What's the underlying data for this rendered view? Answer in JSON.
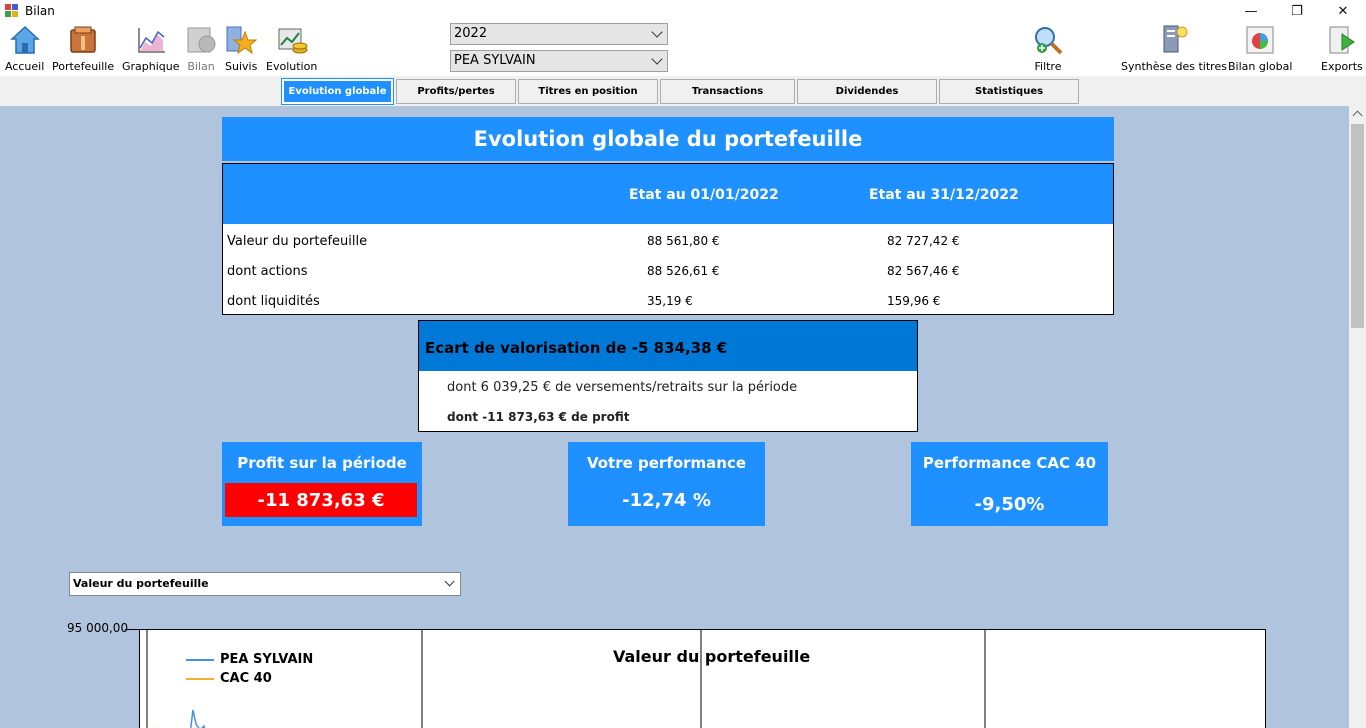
{
  "window": {
    "title": "Bilan",
    "minimize": "—",
    "restore": "❐",
    "close": "✕"
  },
  "toolbar": {
    "items": [
      {
        "label": "Accueil",
        "icon": "home-icon"
      },
      {
        "label": "Portefeuille",
        "icon": "portfolio-icon"
      },
      {
        "label": "Graphique",
        "icon": "chart-icon"
      },
      {
        "label": "Bilan",
        "icon": "balance-icon"
      },
      {
        "label": "Suivis",
        "icon": "star-icon"
      },
      {
        "label": "Evolution",
        "icon": "evolution-icon"
      },
      {
        "label": "Filtre",
        "icon": "filter-icon"
      },
      {
        "label": "Synthèse des titres",
        "icon": "summary-icon"
      },
      {
        "label": "Bilan global",
        "icon": "global-report-icon"
      },
      {
        "label": "Exports",
        "icon": "export-icon"
      }
    ],
    "year_select": "2022",
    "portfolio_select": "PEA SYLVAIN"
  },
  "tabs": [
    {
      "label": "Evolution globale",
      "active": true
    },
    {
      "label": "Profits/pertes",
      "active": false
    },
    {
      "label": "Titres en position",
      "active": false
    },
    {
      "label": "Transactions",
      "active": false
    },
    {
      "label": "Dividendes",
      "active": false
    },
    {
      "label": "Statistiques",
      "active": false
    }
  ],
  "main": {
    "banner": "Evolution globale du portefeuille",
    "etat": {
      "col1": "Etat au 01/01/2022",
      "col2": "Etat au 31/12/2022",
      "rows": [
        {
          "label": "Valeur du portefeuille",
          "v1": "88 561,80 €",
          "v2": "82 727,42 €"
        },
        {
          "label": "dont actions",
          "v1": "88 526,61 €",
          "v2": "82 567,46 €"
        },
        {
          "label": "dont liquidités",
          "v1": "35,19 €",
          "v2": "159,96 €"
        }
      ]
    },
    "ecart": {
      "title": "Ecart de valorisation de -5 834,38 €",
      "line1": "dont 6 039,25 € de versements/retraits sur la période",
      "line2": "dont -11 873,63 € de profit"
    },
    "kpis": {
      "profit_label": "Profit sur la période",
      "profit_value": "-11 873,63 €",
      "perf_label": "Votre performance",
      "perf_value": "-12,74 %",
      "cac_label": "Performance CAC 40",
      "cac_value": "-9,50%"
    },
    "chart_select": "Valeur du portefeuille",
    "chart": {
      "ylabel_top": "95 000,00",
      "title": "Valeur du portefeuille",
      "legend": [
        {
          "name": "PEA SYLVAIN",
          "color": "#4a90e2"
        },
        {
          "name": "CAC 40",
          "color": "#f0b030"
        }
      ]
    }
  },
  "colors": {
    "accent": "#1e90ff",
    "content_bg": "#b0c4de",
    "ecart_head": "#0078d7",
    "loss": "#ff0000"
  }
}
